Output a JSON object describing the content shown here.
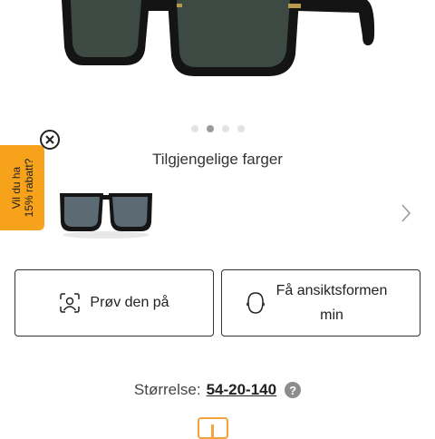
{
  "gallery": {
    "total_slides": 4,
    "active_slide": 2
  },
  "colors": {
    "title": "Tilgjengelige farger"
  },
  "promo": {
    "line1": "Vil du ha",
    "line2": "15% rabatt?"
  },
  "actions": {
    "try_label": "Prøv den på",
    "face_label": "Få ansiktsformen min"
  },
  "size": {
    "label": "Størrelse:",
    "value": "54-20-140"
  },
  "theme": {
    "accent": "#f7a21b",
    "border": "#333333",
    "dot_active": "#9a9a9a",
    "dot_inactive": "#e3e3e3"
  }
}
